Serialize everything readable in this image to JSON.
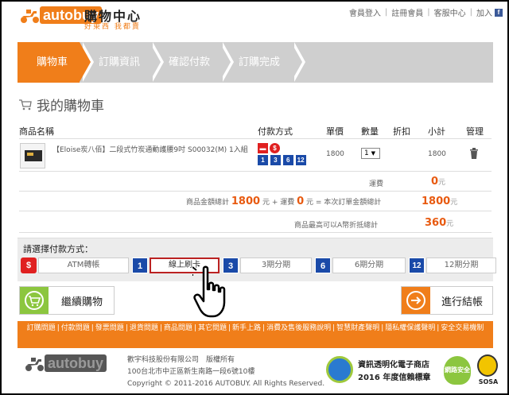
{
  "header": {
    "logo_prefix": "auto",
    "logo_suffix": "buy",
    "site_title": "購物中心",
    "site_subtitle": "好東西 我都賣",
    "top_links": [
      "會員登入",
      "註冊會員",
      "客服中心",
      "加入"
    ],
    "fb_icon": "f"
  },
  "steps": [
    "購物車",
    "訂購資訊",
    "確認付款",
    "訂購完成"
  ],
  "cart": {
    "title": "我的購物車",
    "columns": [
      "商品名稱",
      "付款方式",
      "單價",
      "數量",
      "折扣",
      "小計",
      "管理"
    ],
    "items": [
      {
        "name": "【Eloise炭八佰】二段式竹炭通動護腰9吋 S00032(M) 1入組",
        "pay_icons": [
          "red-card",
          "dollar",
          "1",
          "3",
          "6",
          "12"
        ],
        "price": "1800",
        "qty": "1",
        "discount": "",
        "subtotal": "1800"
      }
    ],
    "shipping_label": "運費",
    "shipping_value": "0",
    "unit": "元",
    "total_line": {
      "prefix": "商品金額總計",
      "goods": "1800",
      "mid1": "元 + 運費",
      "shipping": "0",
      "mid2": "元 = 本次訂單金額總計",
      "total": "1800"
    },
    "discount_line": {
      "label": "商品最高可以A幣折抵總計",
      "value": "360"
    }
  },
  "payment": {
    "title": "請選擇付款方式：",
    "options": [
      {
        "icon": "$",
        "icon_color": "red",
        "label": "ATM轉帳",
        "selected": false
      },
      {
        "icon": "1",
        "icon_color": "blue",
        "label": "線上刷卡",
        "selected": true
      },
      {
        "icon": "3",
        "icon_color": "blue",
        "label": "3期分期",
        "selected": false
      },
      {
        "icon": "6",
        "icon_color": "blue",
        "label": "6期分期",
        "selected": false
      },
      {
        "icon": "12",
        "icon_color": "blue",
        "label": "12期分期",
        "selected": false
      }
    ]
  },
  "buttons": {
    "continue": "繼續購物",
    "checkout": "進行結帳"
  },
  "footer_links": [
    "訂購問題",
    "付款問題",
    "發票問題",
    "退貨問題",
    "商品問題",
    "其它問題",
    "新手上路",
    "消費及售後服務說明",
    "智慧財產聲明",
    "隱私權保護聲明",
    "安全交易機制"
  ],
  "footer": {
    "company_line1": "歡宇科技股份有限公司　版權所有",
    "company_line2": "100台北市中正區新生南路一段6號10樓",
    "copyright": "Copyright © 2011-2016 AUTOBUY. All Rights Reserved.",
    "badge_title": "資訊透明化電子商店",
    "badge_year": "2016 年度信賴標章",
    "badge2_text": "網路安全",
    "badge3_text": "SOSA"
  },
  "colors": {
    "accent": "#f07e1a",
    "price": "#e85a10",
    "selected_border": "#b22222",
    "pay_blue": "#1a4aa8",
    "pay_red": "#e02020",
    "green": "#8cc63f"
  }
}
